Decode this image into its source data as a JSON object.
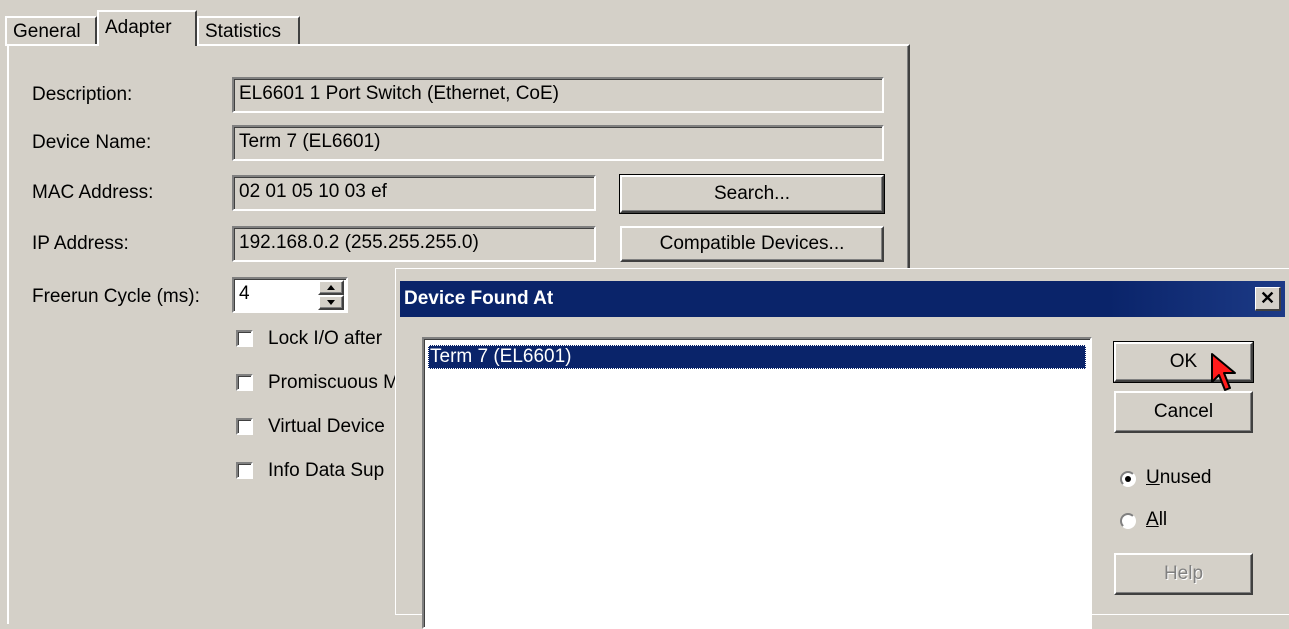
{
  "tabs": [
    {
      "label": "General",
      "active": false
    },
    {
      "label": "Adapter",
      "active": true
    },
    {
      "label": "Statistics",
      "active": false
    }
  ],
  "adapter": {
    "description_label": "Description:",
    "description_value": "EL6601 1 Port Switch (Ethernet, CoE)",
    "device_name_label": "Device Name:",
    "device_name_value": "Term 7 (EL6601)",
    "mac_label": "MAC Address:",
    "mac_value": "02 01 05 10 03 ef",
    "ip_label": "IP Address:",
    "ip_value": "192.168.0.2 (255.255.255.0)",
    "freerun_label": "Freerun Cycle (ms):",
    "freerun_value": "4",
    "search_button": "Search...",
    "compatible_button": "Compatible Devices...",
    "checkboxes": [
      {
        "label": "Lock I/O after",
        "checked": false
      },
      {
        "label": "Promiscuous M",
        "checked": false
      },
      {
        "label": "Virtual Device",
        "checked": false
      },
      {
        "label": "Info Data Sup",
        "checked": false
      }
    ]
  },
  "dialog": {
    "title": "Device Found At",
    "close_glyph": "✕",
    "list_items": [
      "Term 7 (EL6601)"
    ],
    "selected_index": 0,
    "ok_button": "OK",
    "cancel_button": "Cancel",
    "radio_unused_prefix": "",
    "radio_unused_accel": "U",
    "radio_unused_rest": "nused",
    "radio_all_accel": "A",
    "radio_all_rest": "ll",
    "selected_radio": "Unused",
    "help_button": "Help"
  },
  "colors": {
    "face": "#d4d0c8",
    "titlebar": "#0a246a",
    "selection": "#0a246a",
    "cursor": "#ff0000"
  }
}
